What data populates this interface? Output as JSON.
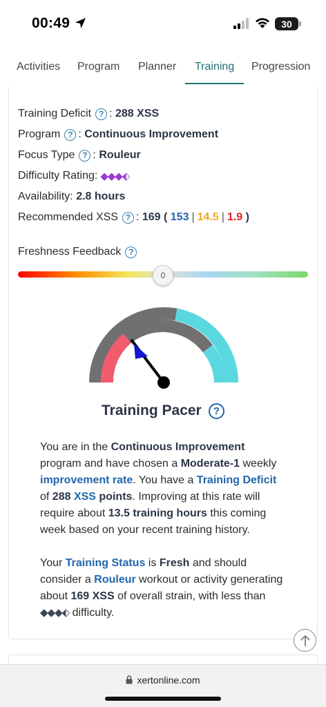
{
  "status_bar": {
    "time": "00:49",
    "battery": "30"
  },
  "tabs": [
    {
      "label": "Activities"
    },
    {
      "label": "Program"
    },
    {
      "label": "Planner"
    },
    {
      "label": "Training"
    },
    {
      "label": "Progression"
    }
  ],
  "active_tab": "Training",
  "summary": {
    "training_deficit": {
      "label": "Training Deficit",
      "value": "288 XSS"
    },
    "program": {
      "label": "Program",
      "value": "Continuous Improvement"
    },
    "focus_type": {
      "label": "Focus Type",
      "value": "Rouleur"
    },
    "difficulty": {
      "label": "Difficulty Rating:",
      "diamonds": "◆◆◆⬖"
    },
    "availability": {
      "label": "Availability:",
      "value": "2.8 hours"
    },
    "recommended": {
      "label": "Recommended XSS",
      "total": "169",
      "low": "153",
      "high": "14.5",
      "peak": "1.9"
    }
  },
  "freshness": {
    "label": "Freshness Feedback",
    "value": "0"
  },
  "pacer": {
    "title": "Training Pacer"
  },
  "paragraph1": {
    "t1": "You are in the ",
    "program": "Continuous Improvement",
    "t2": " program and have chosen a ",
    "rate": "Moderate-1",
    "t3": " weekly ",
    "rate_link": "improvement rate",
    "t4": ". You have a ",
    "deficit_link": "Training Deficit",
    "t5": " of ",
    "deficit_val": "288",
    "xss_link": "XSS",
    "points": "points",
    "t6": ". Improving at this rate will require about ",
    "hours": "13.5 training hours",
    "t7": " this coming week based on your recent training history."
  },
  "paragraph2": {
    "t1": "Your ",
    "status_link": "Training Status",
    "t2": " is ",
    "status": "Fresh",
    "t3": " and should consider a ",
    "focus_link": "Rouleur",
    "t4": " workout or activity generating about ",
    "xss": "169 XSS",
    "t5": " of overall strain, with less than ",
    "diamonds": "◆◆◆⬖",
    "t6": " difficulty."
  },
  "browser": {
    "url": "xertonline.com"
  },
  "colors": {
    "accent": "#1f6f74",
    "link": "#2166ac",
    "gauge_grey": "#707070",
    "gauge_pink": "#f25a6e",
    "gauge_cyan": "#5ad8e0"
  }
}
